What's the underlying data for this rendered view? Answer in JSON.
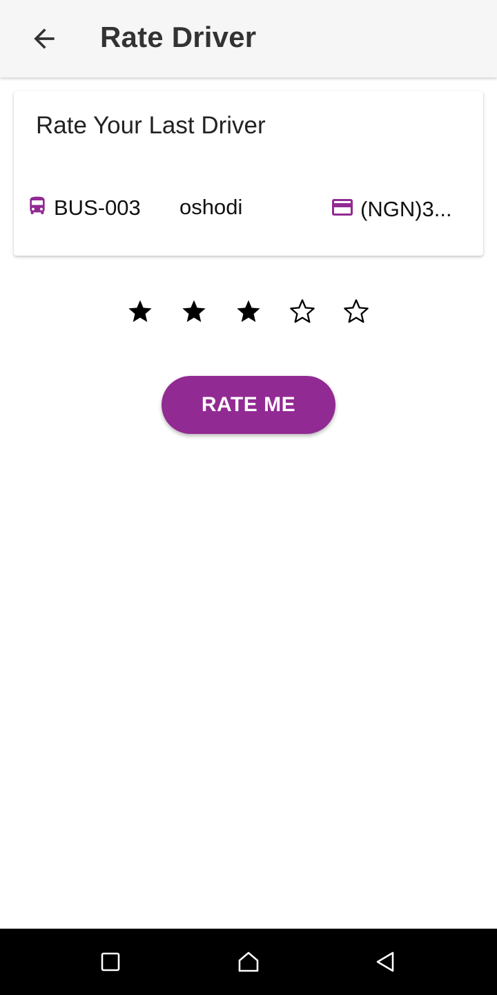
{
  "app_bar": {
    "back_icon": "arrow-left-icon",
    "title": "Rate Driver"
  },
  "card": {
    "title": "Rate Your Last Driver",
    "bus": {
      "icon": "bus-icon",
      "label": "BUS-003"
    },
    "route": {
      "label": "oshodi"
    },
    "fare": {
      "icon": "credit-card-icon",
      "label": "(NGN)3..."
    }
  },
  "rating": {
    "value": 3,
    "max": 5,
    "filled_icon": "star-filled-icon",
    "empty_icon": "star-outline-icon"
  },
  "rate_button": {
    "label": "RATE ME"
  },
  "nav_bar": {
    "recents_icon": "square-icon",
    "home_icon": "home-icon",
    "back_icon": "triangle-back-icon"
  },
  "colors": {
    "accent": "#922a93",
    "app_bar_bg": "#f6f6f6",
    "nav_bar_bg": "#000000"
  }
}
